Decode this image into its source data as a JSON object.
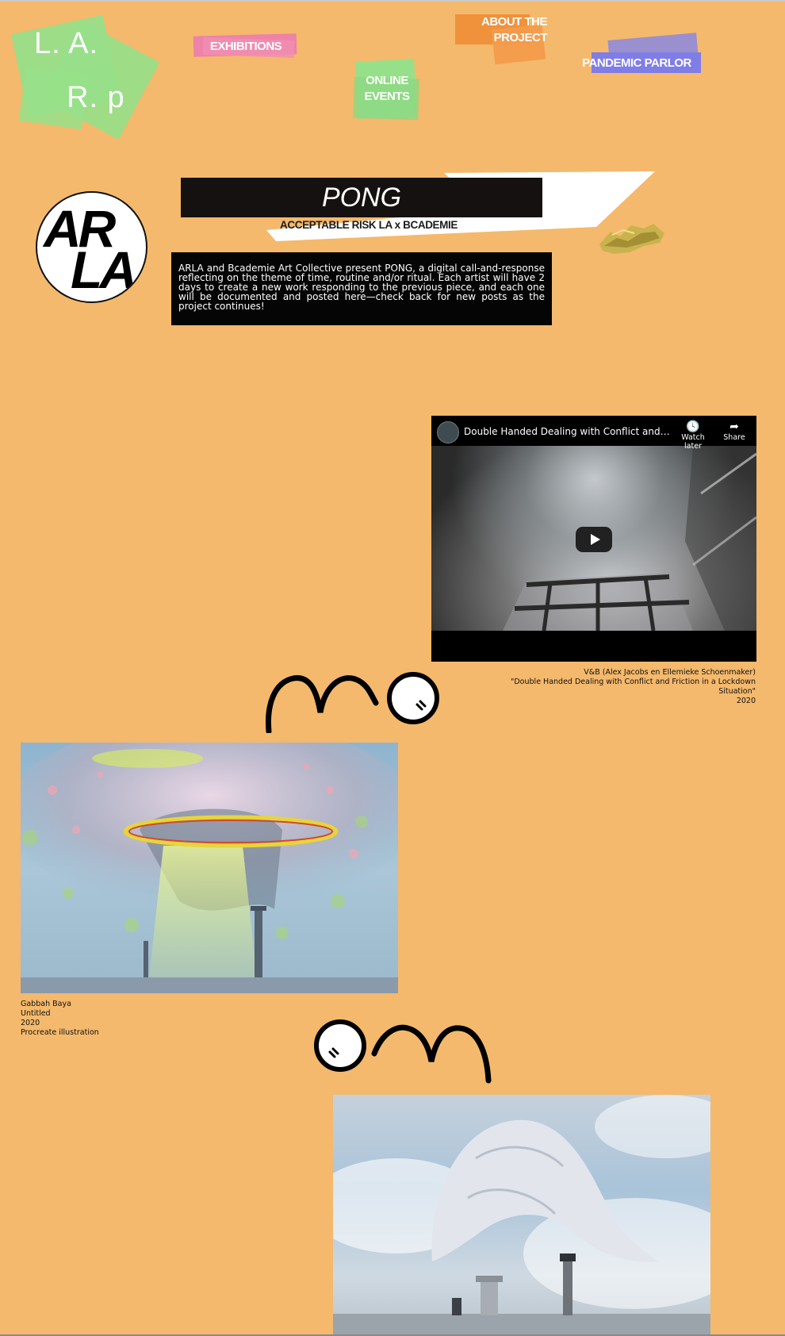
{
  "nav": {
    "logo": {
      "line1": "L. A.",
      "line2": "R. p"
    },
    "items": [
      {
        "label": "EXHIBITIONS"
      },
      {
        "label_line1": "ONLINE",
        "label_line2": "EVENTS"
      },
      {
        "label_line1": "ABOUT THE",
        "label_line2": "PROJECT"
      },
      {
        "label": "PANDEMIC PARLOR"
      }
    ]
  },
  "header": {
    "logo_top": "AR",
    "logo_bottom": "LA",
    "title": "PONG",
    "subtitle": "ACCEPTABLE RISK LA x BCADEMIE",
    "description": "ARLA and Bcademie Art Collective present PONG, a digital call-and-response reflecting on the theme of time, routine and/or ritual. Each artist will have 2 days to create a new work responding to the previous piece, and each one will be documented and posted here—check back for new posts as the project continues!"
  },
  "video": {
    "title": "Double Handed Dealing with Conflict and Frict…",
    "watch_later": "Watch later",
    "share": "Share"
  },
  "works": [
    {
      "artist": "V&B (Alex Jacobs en Ellemieke Schoenmaker)",
      "title": "\"Double Handed Dealing with Conflict and Friction in a Lockdown Situation\"",
      "year": "2020"
    },
    {
      "artist": "Gabbah Baya",
      "title": "Untitled",
      "year": "2020",
      "medium": "Procreate illustration"
    }
  ],
  "colors": {
    "background": "#f4b96c",
    "logo_green": "#96e08a",
    "exhibitions_pink": "#ee82a8",
    "about_orange": "#f0913c",
    "parlor_blue": "#7f7de6"
  }
}
